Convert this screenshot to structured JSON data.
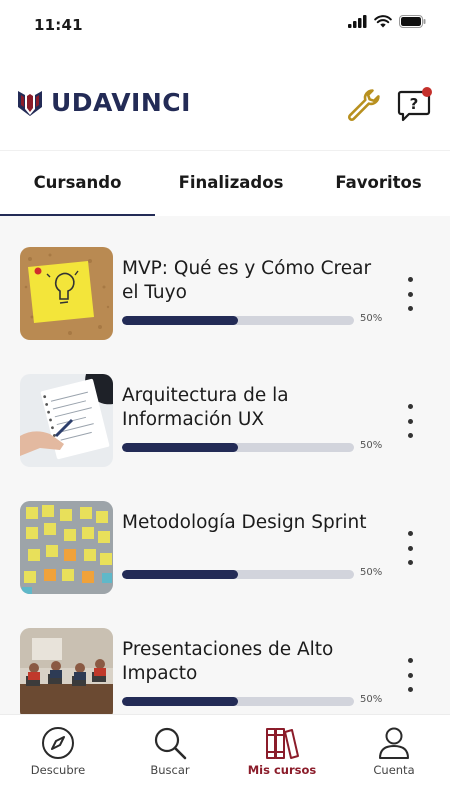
{
  "status_bar": {
    "time": "11:41"
  },
  "header": {
    "brand": "UDAVINCI",
    "brand_color": "#232b56",
    "accent_color": "#8b1c2a",
    "tools_icon": "wrench-icon",
    "help_icon": "help-chat-icon"
  },
  "tabs": [
    {
      "label": "Cursando",
      "active": true
    },
    {
      "label": "Finalizados",
      "active": false
    },
    {
      "label": "Favoritos",
      "active": false
    }
  ],
  "courses": [
    {
      "title": "MVP: Qué es y Cómo Crear el Tuyo",
      "progress_label": "50%",
      "progress": 0.5,
      "thumb": "sticky-note-lightbulb"
    },
    {
      "title": "Arquitectura de la Información UX",
      "progress_label": "50%",
      "progress": 0.5,
      "thumb": "notebook-writing"
    },
    {
      "title": "Metodología Design Sprint",
      "progress_label": "50%",
      "progress": 0.5,
      "thumb": "post-its-board"
    },
    {
      "title": "Presentaciones de Alto Impacto",
      "progress_label": "50%",
      "progress": 0.5,
      "thumb": "classroom-laptops"
    }
  ],
  "bottom_nav": [
    {
      "label": "Descubre",
      "icon": "compass-icon",
      "active": false
    },
    {
      "label": "Buscar",
      "icon": "search-icon",
      "active": false
    },
    {
      "label": "Mis cursos",
      "icon": "books-icon",
      "active": true
    },
    {
      "label": "Cuenta",
      "icon": "user-icon",
      "active": false
    }
  ]
}
